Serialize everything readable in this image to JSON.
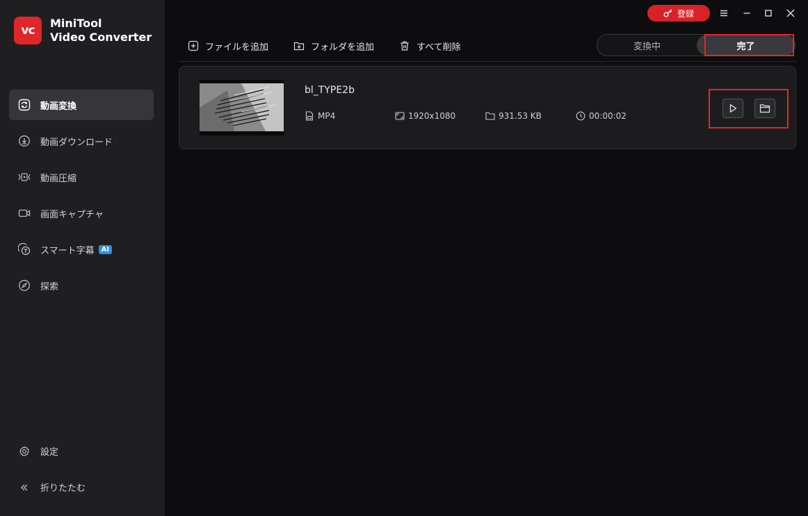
{
  "app": {
    "name_line1": "MiniTool",
    "name_line2": "Video Converter",
    "logo_text": "vc"
  },
  "sidebar": {
    "items": [
      {
        "label": "動画変換",
        "icon": "convert-icon",
        "active": true
      },
      {
        "label": "動画ダウンロード",
        "icon": "download-icon"
      },
      {
        "label": "動画圧縮",
        "icon": "compress-icon"
      },
      {
        "label": "画面キャプチャ",
        "icon": "camera-icon"
      },
      {
        "label": "スマート字幕",
        "icon": "subtitle-icon",
        "badge": "AI"
      },
      {
        "label": "探索",
        "icon": "compass-icon"
      }
    ],
    "settings_label": "設定",
    "collapse_label": "折りたたむ"
  },
  "window": {
    "register_label": "登録"
  },
  "toolbar": {
    "add_file": "ファイルを追加",
    "add_folder": "フォルダを追加",
    "delete_all": "すべて削除"
  },
  "tabs": {
    "converting": "変換中",
    "done": "完了"
  },
  "file": {
    "name": "bl_TYPE2b",
    "format": "MP4",
    "resolution": "1920x1080",
    "size": "931.53 KB",
    "duration": "00:00:02"
  },
  "colors": {
    "accent": "#e0262b",
    "highlight": "#e8242a",
    "ai_badge": "#2f8fe8"
  }
}
